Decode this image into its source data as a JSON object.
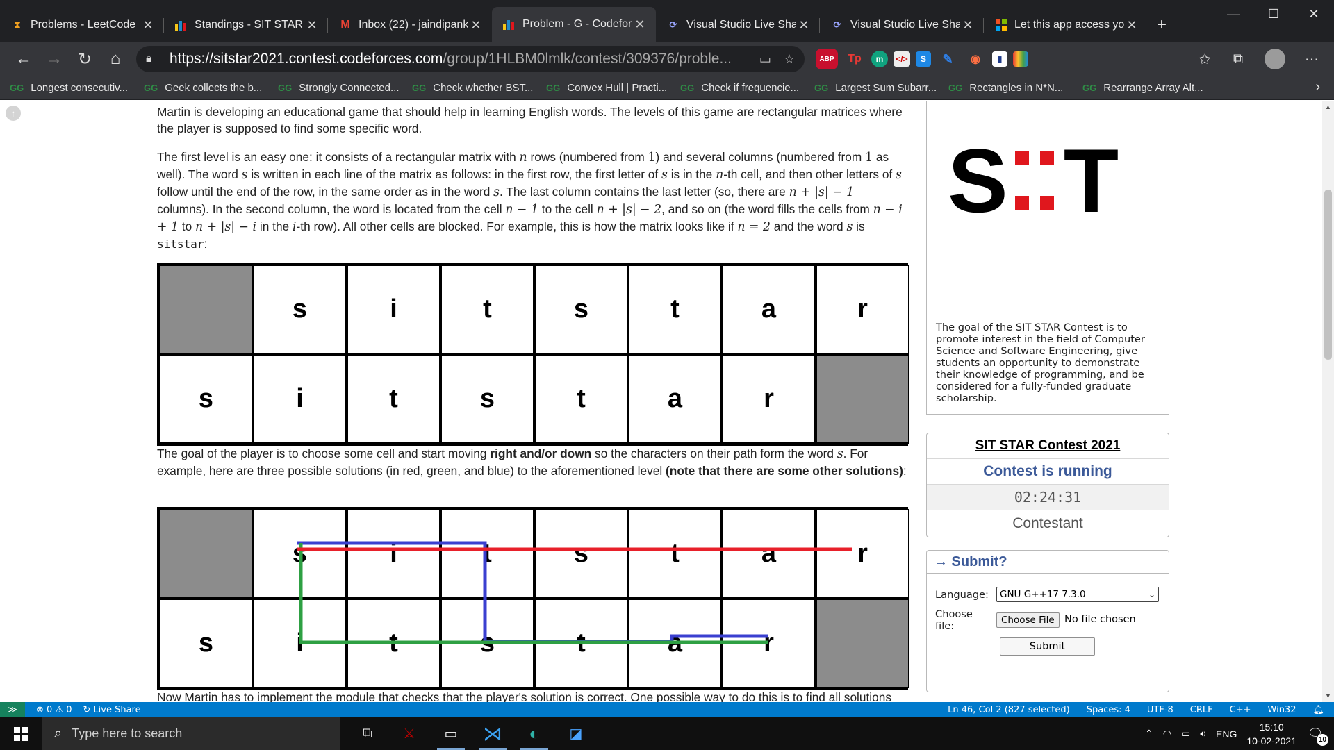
{
  "browser": {
    "tabs": [
      {
        "title": "Problems - LeetCode",
        "icon": "leetcode-icon",
        "active": false
      },
      {
        "title": "Standings - SIT STAR C",
        "icon": "codeforces-icon",
        "active": false
      },
      {
        "title": "Inbox (22) - jaindipank",
        "icon": "gmail-icon",
        "active": false
      },
      {
        "title": "Problem - G - Codeforc",
        "icon": "codeforces-icon",
        "active": true
      },
      {
        "title": "Visual Studio Live Shar",
        "icon": "live-share-icon",
        "active": false
      },
      {
        "title": "Visual Studio Live Shar",
        "icon": "live-share-icon",
        "active": false
      },
      {
        "title": "Let this app access you",
        "icon": "microsoft-icon",
        "active": false
      }
    ],
    "url_host": "https://sitstar2021.contest.codeforces.com",
    "url_path": "/group/1HLBM0lmlk/contest/309376/proble...",
    "extensions": [
      "ABP",
      "Tp",
      "m",
      "</>",
      "S",
      "",
      "",
      "",
      ""
    ],
    "bookmarks": [
      "Longest consecutiv...",
      "Geek collects the b...",
      "Strongly Connected...",
      "Check whether BST...",
      "Convex Hull | Practi...",
      "Check if frequencie...",
      "Largest Sum Subarr...",
      "Rectangles in N*N...",
      "Rearrange Array Alt..."
    ],
    "bookmark_icon_text": "GG"
  },
  "problem": {
    "p1": "Martin is developing an educational game that should help in learning English words. The levels of this game are rectangular matrices where the player is supposed to find some specific word.",
    "p2a": "The first level is an easy one: it consists of a rectangular matrix with ",
    "p2b": " rows (numbered from ",
    "p2c": ") and several columns (numbered from ",
    "p2d": " as well). The word ",
    "p2e": " is written in each line of the matrix as follows: in the first row, the first letter of ",
    "p2f": " is in the ",
    "p2g": "-th cell, and then other letters of ",
    "p2h": " follow until the end of the row, in the same order as in the word ",
    "p2i": ". The last column contains the last letter (so, there are ",
    "p2j": " columns). In the second column, the word is located from the cell ",
    "p2k": " to the cell ",
    "p2l": ", and so on (the word fills the cells from ",
    "p2m": " to ",
    "p2n": " in the ",
    "p2o": "-th row). All other cells are blocked. For example, this is how the matrix looks like if ",
    "p2p": " and the word ",
    "p2q": " is ",
    "word": "sitstar",
    "p2end": ":",
    "math_n": "n",
    "math_s": "s",
    "math_i": "i",
    "math_one": "1",
    "math_cols": "n + |s| − 1",
    "math_nm1": "n − 1",
    "math_ns2": "n + |s| − 2",
    "math_from": "n − i + 1",
    "math_to": "n + |s| − i",
    "math_n2": "n = 2",
    "p3a": "The goal of the player is to choose some cell and start moving ",
    "p3b": "right and/or down",
    "p3c": " so the characters on their path form the word ",
    "p3d": ". For example, here are three possible solutions (in red, green, and blue) to the aforementioned level ",
    "p3e": "(note that there are some other solutions)",
    "p3f": ":",
    "p4": "Now Martin has to implement the module that checks that the player's solution is correct. One possible way to do this is to find all solutions",
    "grid_row1": [
      "",
      "s",
      "i",
      "t",
      "s",
      "t",
      "a",
      "r"
    ],
    "grid_row2": [
      "s",
      "i",
      "t",
      "s",
      "t",
      "a",
      "r",
      ""
    ],
    "path_colors": {
      "red": "#e8202a",
      "green": "#2ea043",
      "blue": "#3a3fd0"
    }
  },
  "sidebar": {
    "logo_left": "S",
    "logo_right": "T",
    "description": "The goal of the SIT STAR Contest is to promote interest in the field of Computer Science and Software Engineering, give students an opportunity to demonstrate their knowledge of programming, and be considered for a fully-funded graduate scholarship.",
    "contest_name": "SIT STAR Contest 2021",
    "contest_status": "Contest is running",
    "timer": "02:24:31",
    "role": "Contestant",
    "submit_title": "→ Submit?",
    "language_label": "Language:",
    "language_value": "GNU G++17 7.3.0",
    "file_label": "Choose file:",
    "file_button": "Choose File",
    "file_status": "No file chosen",
    "submit_button": "Submit"
  },
  "vscode_status": {
    "errors": "⊗ 0 ⚠ 0",
    "live_share": "Live Share",
    "position": "Ln 46, Col 2 (827 selected)",
    "spaces": "Spaces: 4",
    "encoding": "UTF-8",
    "eol": "CRLF",
    "language": "C++",
    "platform": "Win32"
  },
  "taskbar": {
    "search_placeholder": "Type here to search",
    "time": "15:10",
    "date": "10-02-2021",
    "lang": "ENG",
    "notifications": "10"
  }
}
